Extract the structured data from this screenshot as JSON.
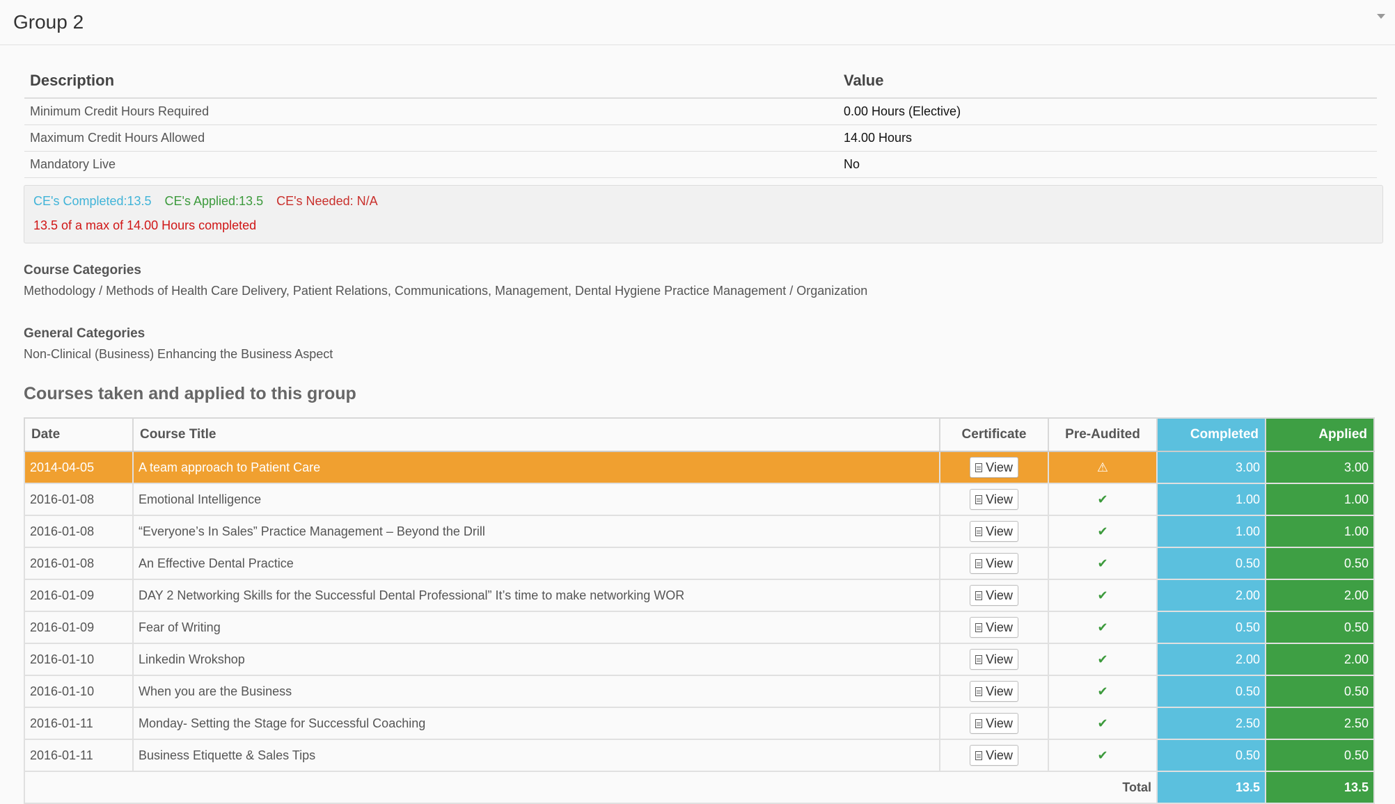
{
  "panel": {
    "title": "Group 2"
  },
  "description_table": {
    "headers": {
      "description": "Description",
      "value": "Value"
    },
    "rows": [
      {
        "description": "Minimum Credit Hours Required",
        "value": "0.00 Hours (Elective)"
      },
      {
        "description": "Maximum Credit Hours Allowed",
        "value": "14.00 Hours"
      },
      {
        "description": "Mandatory Live",
        "value": "No"
      }
    ]
  },
  "summary": {
    "completed": "CE's Completed:13.5",
    "applied": "CE's Applied:13.5",
    "needed": "CE's Needed: N/A",
    "progress_text": "13.5 of a max of 14.00 Hours completed"
  },
  "course_categories": {
    "title": "Course Categories",
    "text": "Methodology / Methods of Health Care Delivery, Patient Relations, Communications, Management, Dental Hygiene Practice Management / Organization"
  },
  "general_categories": {
    "title": "General Categories",
    "text": "Non-Clinical (Business) Enhancing the Business Aspect"
  },
  "courses_heading": "Courses taken and applied to this group",
  "courses_table": {
    "headers": {
      "date": "Date",
      "title": "Course Title",
      "certificate": "Certificate",
      "pre_audited": "Pre-Audited",
      "completed": "Completed",
      "applied": "Applied"
    },
    "view_label": "View",
    "rows": [
      {
        "date": "2014-04-05",
        "title": "A team approach to Patient Care",
        "status_icon": "warning-icon",
        "completed": "3.00",
        "applied": "3.00"
      },
      {
        "date": "2016-01-08",
        "title": "Emotional Intelligence",
        "status_icon": "check-icon",
        "completed": "1.00",
        "applied": "1.00"
      },
      {
        "date": "2016-01-08",
        "title": "“Everyone’s In Sales” Practice Management – Beyond the Drill",
        "status_icon": "check-icon",
        "completed": "1.00",
        "applied": "1.00"
      },
      {
        "date": "2016-01-08",
        "title": "An Effective Dental Practice",
        "status_icon": "check-icon",
        "completed": "0.50",
        "applied": "0.50"
      },
      {
        "date": "2016-01-09",
        "title": "DAY 2 Networking Skills for the Successful Dental Professional” It’s time to make networking WOR",
        "status_icon": "check-icon",
        "completed": "2.00",
        "applied": "2.00"
      },
      {
        "date": "2016-01-09",
        "title": "Fear of Writing",
        "status_icon": "check-icon",
        "completed": "0.50",
        "applied": "0.50"
      },
      {
        "date": "2016-01-10",
        "title": "Linkedin Wrokshop",
        "status_icon": "check-icon",
        "completed": "2.00",
        "applied": "2.00"
      },
      {
        "date": "2016-01-10",
        "title": "When you are the Business",
        "status_icon": "check-icon",
        "completed": "0.50",
        "applied": "0.50"
      },
      {
        "date": "2016-01-11",
        "title": "Monday- Setting the Stage for Successful Coaching",
        "status_icon": "check-icon",
        "completed": "2.50",
        "applied": "2.50"
      },
      {
        "date": "2016-01-11",
        "title": "Business Etiquette & Sales Tips",
        "status_icon": "check-icon",
        "completed": "0.50",
        "applied": "0.50"
      }
    ],
    "total": {
      "label": "Total",
      "completed": "13.5",
      "applied": "13.5"
    }
  },
  "colors": {
    "completed": "#5bc0de",
    "applied": "#3e9f44",
    "warning_row": "#f0a030",
    "needed_text": "#c9302c"
  }
}
